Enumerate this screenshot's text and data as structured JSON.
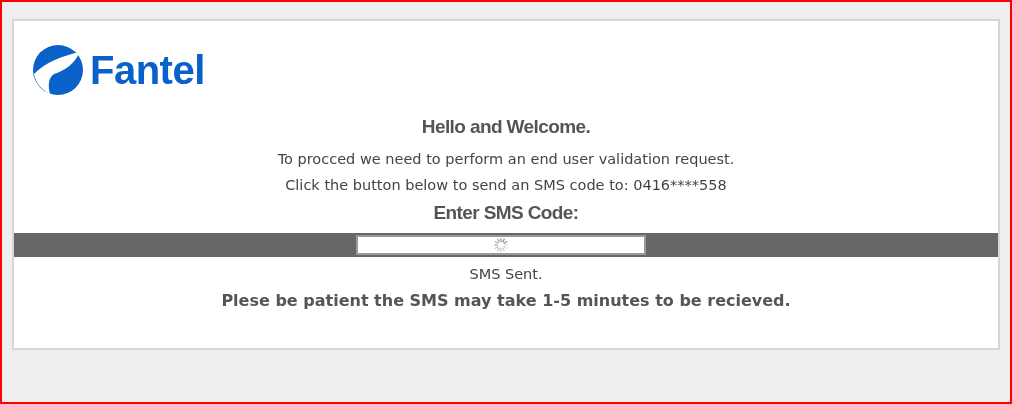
{
  "logo": {
    "text": "Fantel"
  },
  "heading": "Hello and Welcome.",
  "intro_lines": [
    "To procced we need to perform an end user validation request.",
    "Click the button below to send an SMS code to: 0416****558"
  ],
  "code_label": "Enter SMS Code:",
  "code_field": {
    "loading": true
  },
  "status": "SMS Sent.",
  "notice": "Plese be patient the SMS may take 1-5 minutes to be recieved."
}
